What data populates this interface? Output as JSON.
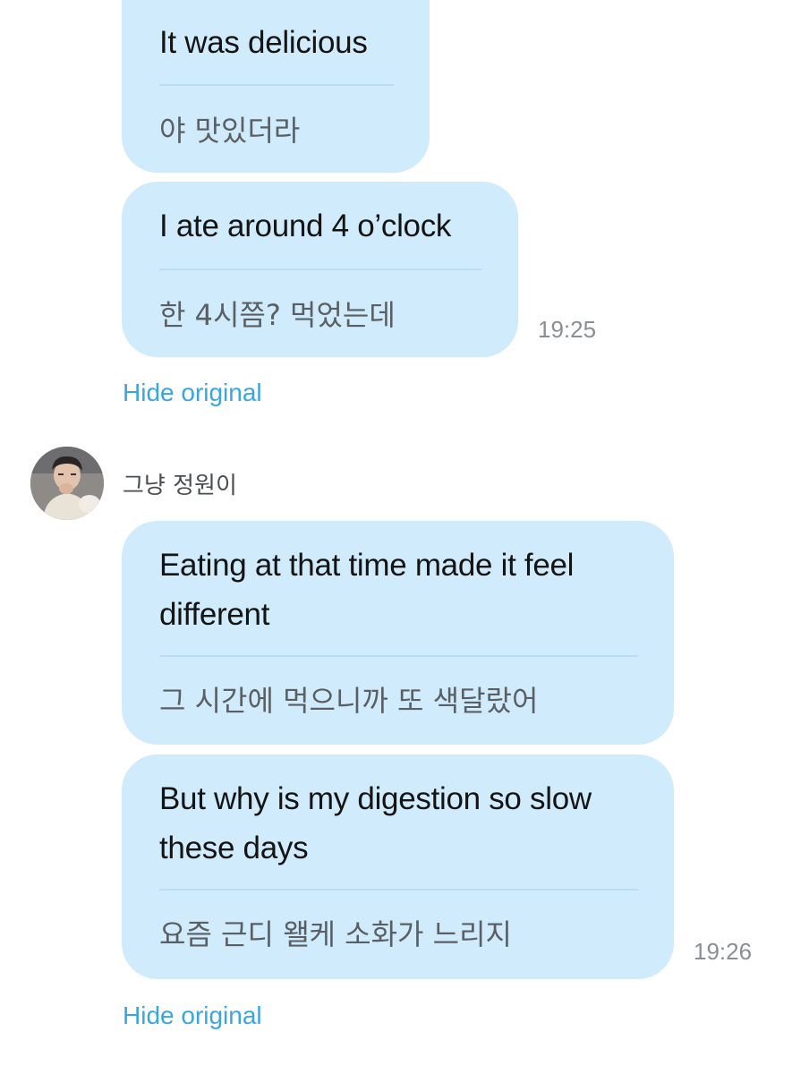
{
  "messages": [
    {
      "translated": "It was delicious",
      "original": "야 맛있더라"
    },
    {
      "translated": "I ate around 4 o’clock",
      "original": "한 4시쯤? 먹었는데",
      "time": "19:25"
    },
    {
      "translated": "Eating at that time made it feel different",
      "original": "그 시간에 먹으니까 또 색달랐어"
    },
    {
      "translated": "But why is my digestion so slow these days",
      "original": "요즘 근디 왤케 소화가 느리지",
      "time": "19:26"
    }
  ],
  "hide_original_label": "Hide original",
  "sender": {
    "name": "그냥 정원이",
    "avatar_icon": "profile-photo"
  },
  "colors": {
    "bubble": "#d0ebfc",
    "link": "#3aa5e0",
    "timestamp": "#8b8f93"
  }
}
